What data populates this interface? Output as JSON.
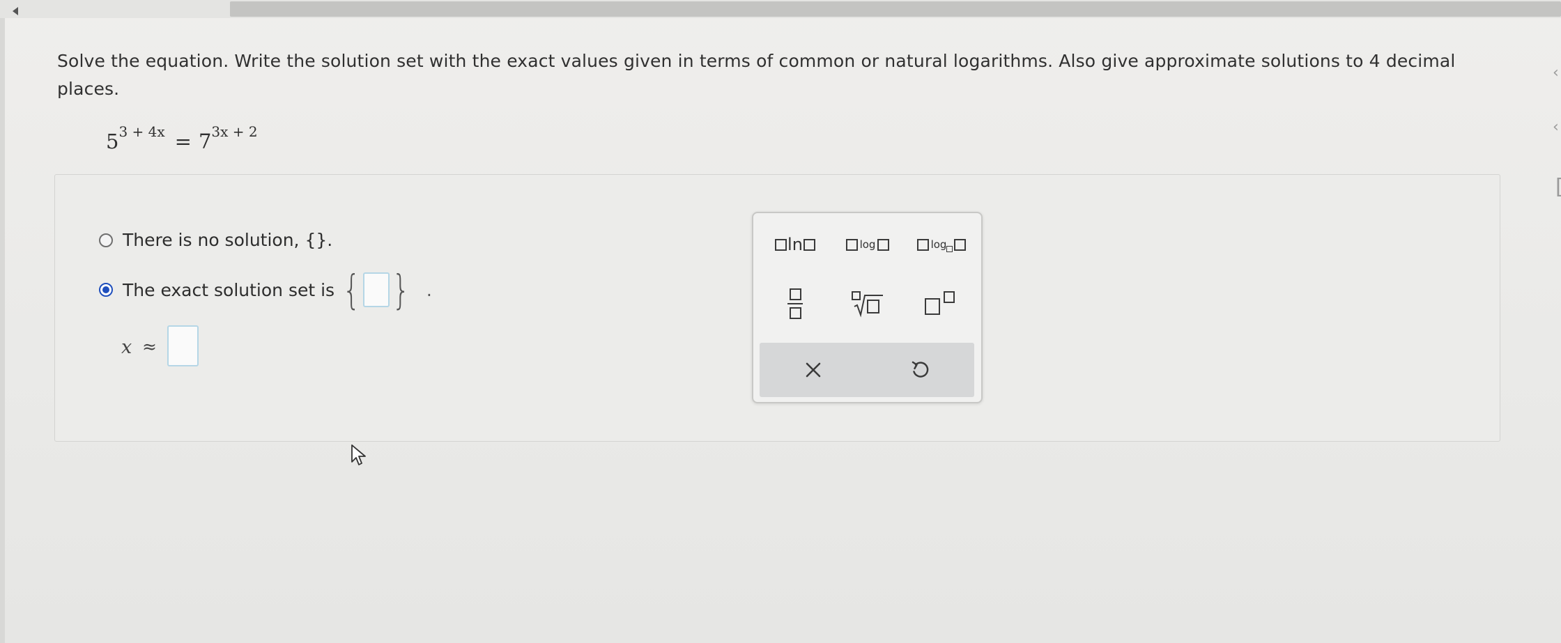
{
  "question": {
    "text": "Solve the equation. Write the solution set with the exact values given in terms of common or natural logarithms. Also give approximate solutions to 4 decimal places."
  },
  "equation": {
    "lhs_base": "5",
    "lhs_exponent": "3 + 4x",
    "equals": "=",
    "rhs_base": "7",
    "rhs_exponent": "3x + 2"
  },
  "options": {
    "no_solution": {
      "label": "There is no solution, {}.",
      "selected": false
    },
    "exact_solution": {
      "label": "The exact solution set is",
      "selected": true,
      "value": "",
      "suffix": "."
    }
  },
  "approx": {
    "variable": "x",
    "symbol": "≈",
    "value": ""
  },
  "keypad": {
    "ln_label": "ln",
    "log_label": "log",
    "logb_label": "log",
    "clear_icon": "close-icon",
    "undo_icon": "undo-icon"
  },
  "colors": {
    "accent": "#1f4fbd",
    "input_border": "#b5d6e6",
    "panel_background": "#ececea",
    "keypad_footer": "#d6d7d8"
  }
}
